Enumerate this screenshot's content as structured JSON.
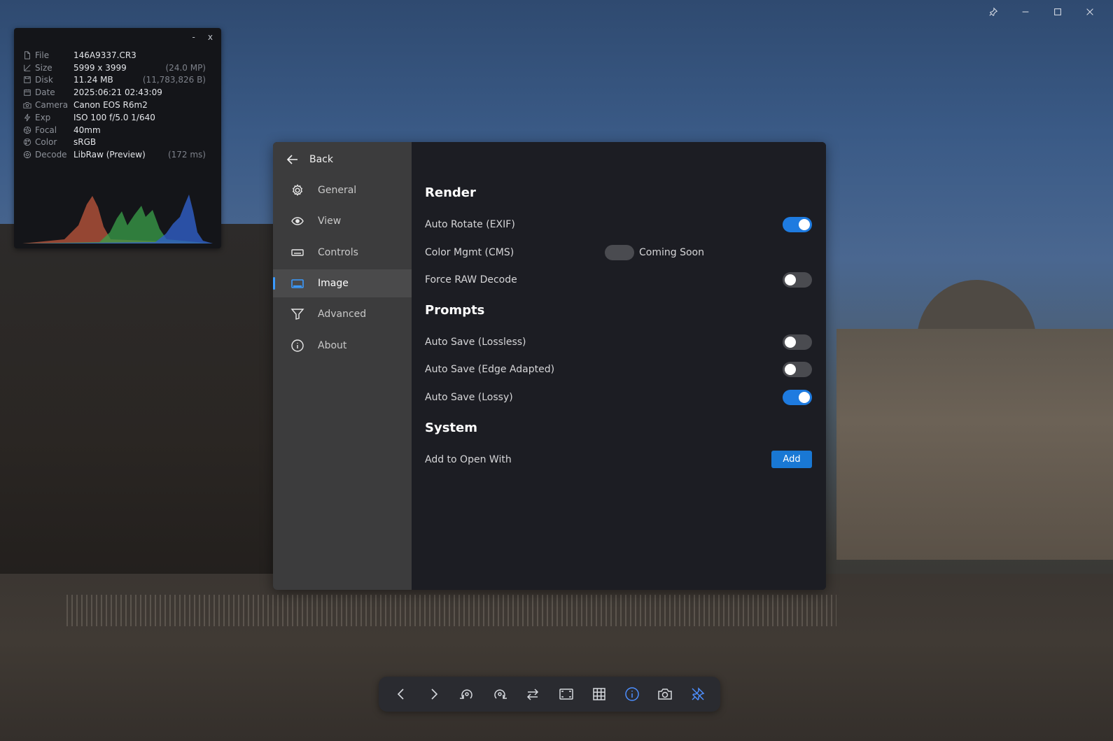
{
  "window": {
    "controls": [
      "pin-icon",
      "minimize-icon",
      "maximize-icon",
      "close-icon"
    ]
  },
  "info_panel": {
    "minimize_label": "-",
    "close_label": "x",
    "rows": [
      {
        "icon": "file-icon",
        "label": "File",
        "value": "146A9337.CR3",
        "extra": ""
      },
      {
        "icon": "size-icon",
        "label": "Size",
        "value": "5999 x 3999",
        "extra": "(24.0 MP)"
      },
      {
        "icon": "disk-icon",
        "label": "Disk",
        "value": "11.24 MB",
        "extra": "(11,783,826 B)"
      },
      {
        "icon": "calendar-icon",
        "label": "Date",
        "value": "2025:06:21 02:43:09",
        "extra": ""
      },
      {
        "icon": "camera-icon",
        "label": "Camera",
        "value": "Canon EOS R6m2",
        "extra": ""
      },
      {
        "icon": "flash-icon",
        "label": "Exp",
        "value": "ISO 100  f/5.0  1/640",
        "extra": ""
      },
      {
        "icon": "aperture-icon",
        "label": "Focal",
        "value": "40mm",
        "extra": ""
      },
      {
        "icon": "palette-icon",
        "label": "Color",
        "value": "sRGB",
        "extra": ""
      },
      {
        "icon": "chip-icon",
        "label": "Decode",
        "value": "LibRaw (Preview)",
        "extra": "(172 ms)"
      }
    ],
    "histogram_colors": {
      "red": "#c0573c",
      "green": "#3aa04a",
      "blue": "#2f5fc8"
    }
  },
  "dialog": {
    "back_label": "Back",
    "nav": [
      {
        "icon": "gear-icon",
        "label": "General",
        "active": false
      },
      {
        "icon": "eye-icon",
        "label": "View",
        "active": false
      },
      {
        "icon": "keyboard-icon",
        "label": "Controls",
        "active": false
      },
      {
        "icon": "image-icon",
        "label": "Image",
        "active": true
      },
      {
        "icon": "filter-icon",
        "label": "Advanced",
        "active": false
      },
      {
        "icon": "info-icon",
        "label": "About",
        "active": false
      }
    ],
    "sections": {
      "render": {
        "title": "Render",
        "auto_rotate": {
          "label": "Auto Rotate (EXIF)",
          "on": true
        },
        "color_mgmt": {
          "label": "Color Mgmt (CMS)",
          "status": "Coming Soon"
        },
        "force_raw": {
          "label": "Force RAW Decode",
          "on": false
        }
      },
      "prompts": {
        "title": "Prompts",
        "lossless": {
          "label": "Auto Save (Lossless)",
          "on": false
        },
        "edge": {
          "label": "Auto Save (Edge Adapted)",
          "on": false
        },
        "lossy": {
          "label": "Auto Save (Lossy)",
          "on": true
        }
      },
      "system": {
        "title": "System",
        "open_with": {
          "label": "Add to Open With",
          "button": "Add"
        }
      }
    },
    "accent_color": "#1e7be0"
  },
  "toolbar": {
    "buttons": [
      "chevron-left-icon",
      "chevron-right-icon",
      "rotate-left-icon",
      "rotate-right-icon",
      "swap-icon",
      "fit-screen-icon",
      "grid-icon",
      "info-circle-icon",
      "camera-icon",
      "pin-off-icon"
    ]
  }
}
